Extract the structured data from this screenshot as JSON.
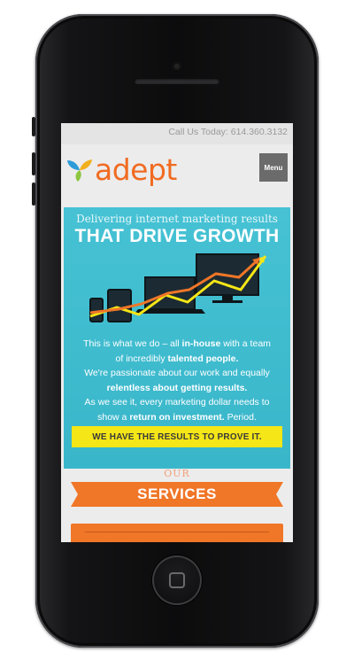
{
  "topbar": {
    "call_text": "Call Us Today: 614.360.3132"
  },
  "header": {
    "logo_text": "adept",
    "menu_label": "Menu"
  },
  "hero": {
    "subtitle": "Delivering internet marketing results",
    "title": "THAT DRIVE GROWTH",
    "body": {
      "l1a": "This is what we do – all ",
      "l1b": "in-house",
      "l1c": " with a team",
      "l2a": "of incredibly ",
      "l2b": "talented people.",
      "l3": "We're passionate about our work and equally",
      "l4": "relentless about getting results.",
      "l5": "As we see it, every marketing dollar needs to",
      "l6a": "show a ",
      "l6b": "return on investment.",
      "l6c": " Period."
    },
    "cta_label": "WE HAVE THE RESULTS TO PROVE IT."
  },
  "services": {
    "kicker": "OUR",
    "title": "SERVICES"
  },
  "colors": {
    "brand_orange": "#f06b21",
    "hero_teal": "#3ab6ca",
    "cta_yellow": "#f5e617"
  }
}
